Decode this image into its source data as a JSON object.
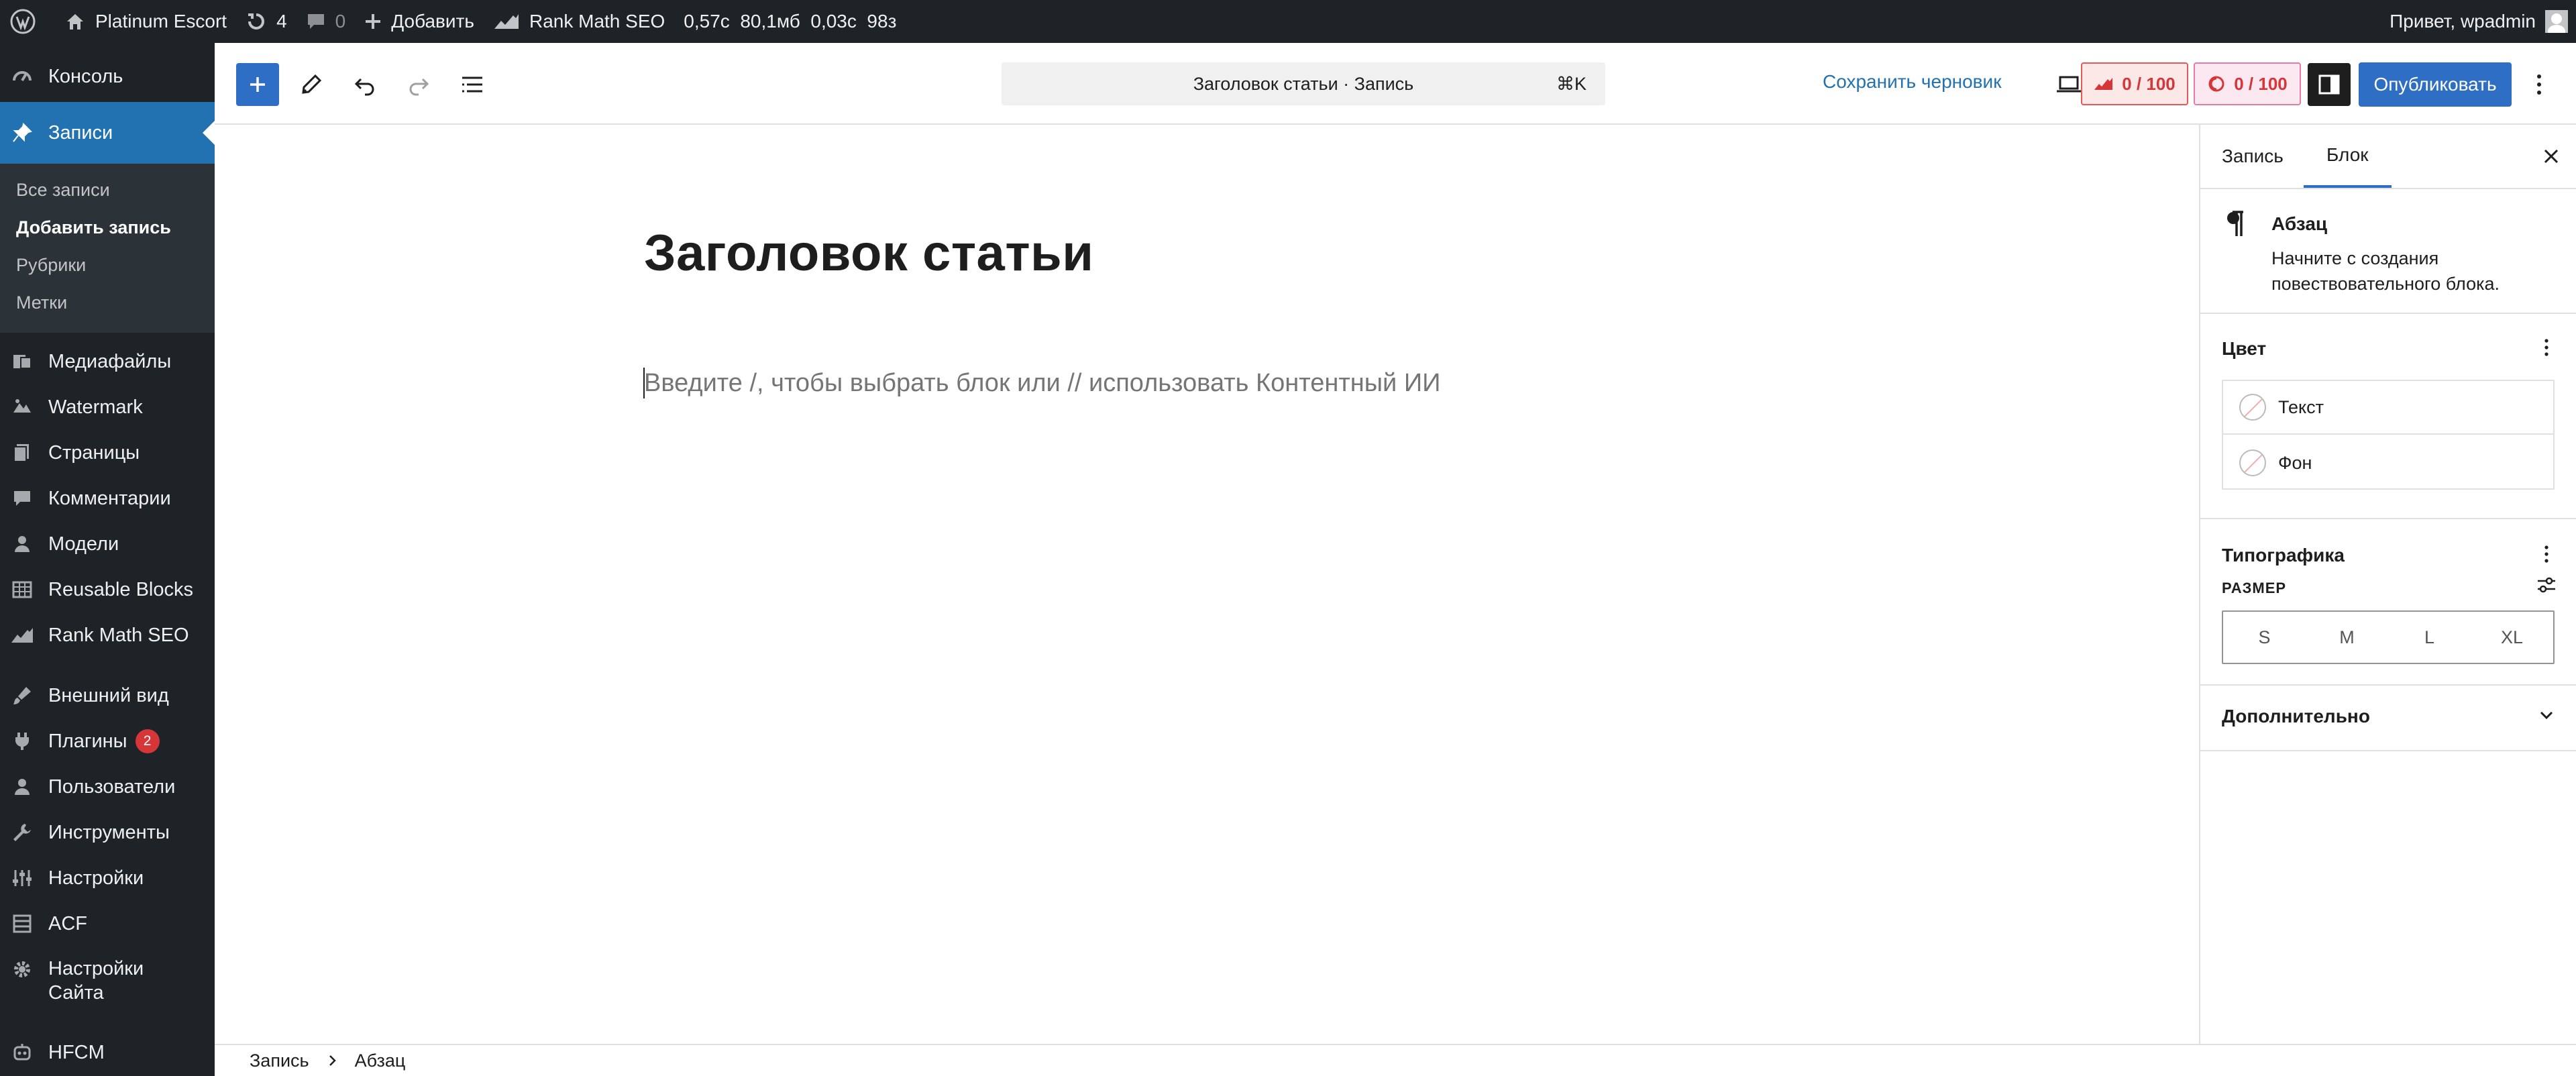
{
  "admin_bar": {
    "site_name": "Platinum Escort",
    "updates_count": "4",
    "comments_count": "0",
    "add_label": "Добавить",
    "seo_label": "Rank Math SEO",
    "metrics": "0,57с  80,1мб  0,03с  98з",
    "greeting": "Привет, wpadmin"
  },
  "sidebar": {
    "items": [
      {
        "label": "Консоль",
        "icon": "dashboard-icon"
      },
      {
        "label": "Записи",
        "icon": "pin-icon"
      },
      {
        "label": "Медиафайлы",
        "icon": "media-icon"
      },
      {
        "label": "Watermark",
        "icon": "watermark-icon"
      },
      {
        "label": "Страницы",
        "icon": "pages-icon"
      },
      {
        "label": "Комментарии",
        "icon": "comments-icon"
      },
      {
        "label": "Модели",
        "icon": "user-icon"
      },
      {
        "label": "Reusable Blocks",
        "icon": "blocks-icon"
      },
      {
        "label": "Rank Math SEO",
        "icon": "rankmath-icon"
      },
      {
        "label": "Внешний вид",
        "icon": "appearance-icon"
      },
      {
        "label": "Плагины",
        "icon": "plugins-icon",
        "badge": "2"
      },
      {
        "label": "Пользователи",
        "icon": "users-icon"
      },
      {
        "label": "Инструменты",
        "icon": "tools-icon"
      },
      {
        "label": "Настройки",
        "icon": "settings-icon"
      },
      {
        "label": "ACF",
        "icon": "acf-icon"
      },
      {
        "label": "Настройки Сайта",
        "icon": "gear-icon"
      },
      {
        "label": "HFCM",
        "icon": "hfcm-icon"
      }
    ],
    "submenu": [
      "Все записи",
      "Добавить запись",
      "Рубрики",
      "Метки"
    ]
  },
  "toolbar": {
    "command_text": "Заголовок статьи · Запись",
    "shortcut": "⌘K",
    "save_draft": "Сохранить черновик",
    "seo_score": "0 / 100",
    "readability_score": "0 / 100",
    "publish": "Опубликовать"
  },
  "editor": {
    "title": "Заголовок статьи",
    "placeholder": "Введите /, чтобы выбрать блок или // использовать Контентный ИИ"
  },
  "footer": {
    "crumb_1": "Запись",
    "crumb_2": "Абзац"
  },
  "inspector": {
    "tab_post": "Запись",
    "tab_block": "Блок",
    "block_name": "Абзац",
    "block_desc": "Начните с создания повествовательного блока.",
    "color_title": "Цвет",
    "color_text": "Текст",
    "color_bg": "Фон",
    "typography_title": "Типографика",
    "size_label": "РАЗМЕР",
    "sizes": [
      "S",
      "M",
      "L",
      "XL"
    ],
    "advanced": "Дополнительно"
  },
  "colors": {
    "accent": "#2f6ec5",
    "admin_bg": "#1d2327",
    "score_red": "#d63638"
  }
}
